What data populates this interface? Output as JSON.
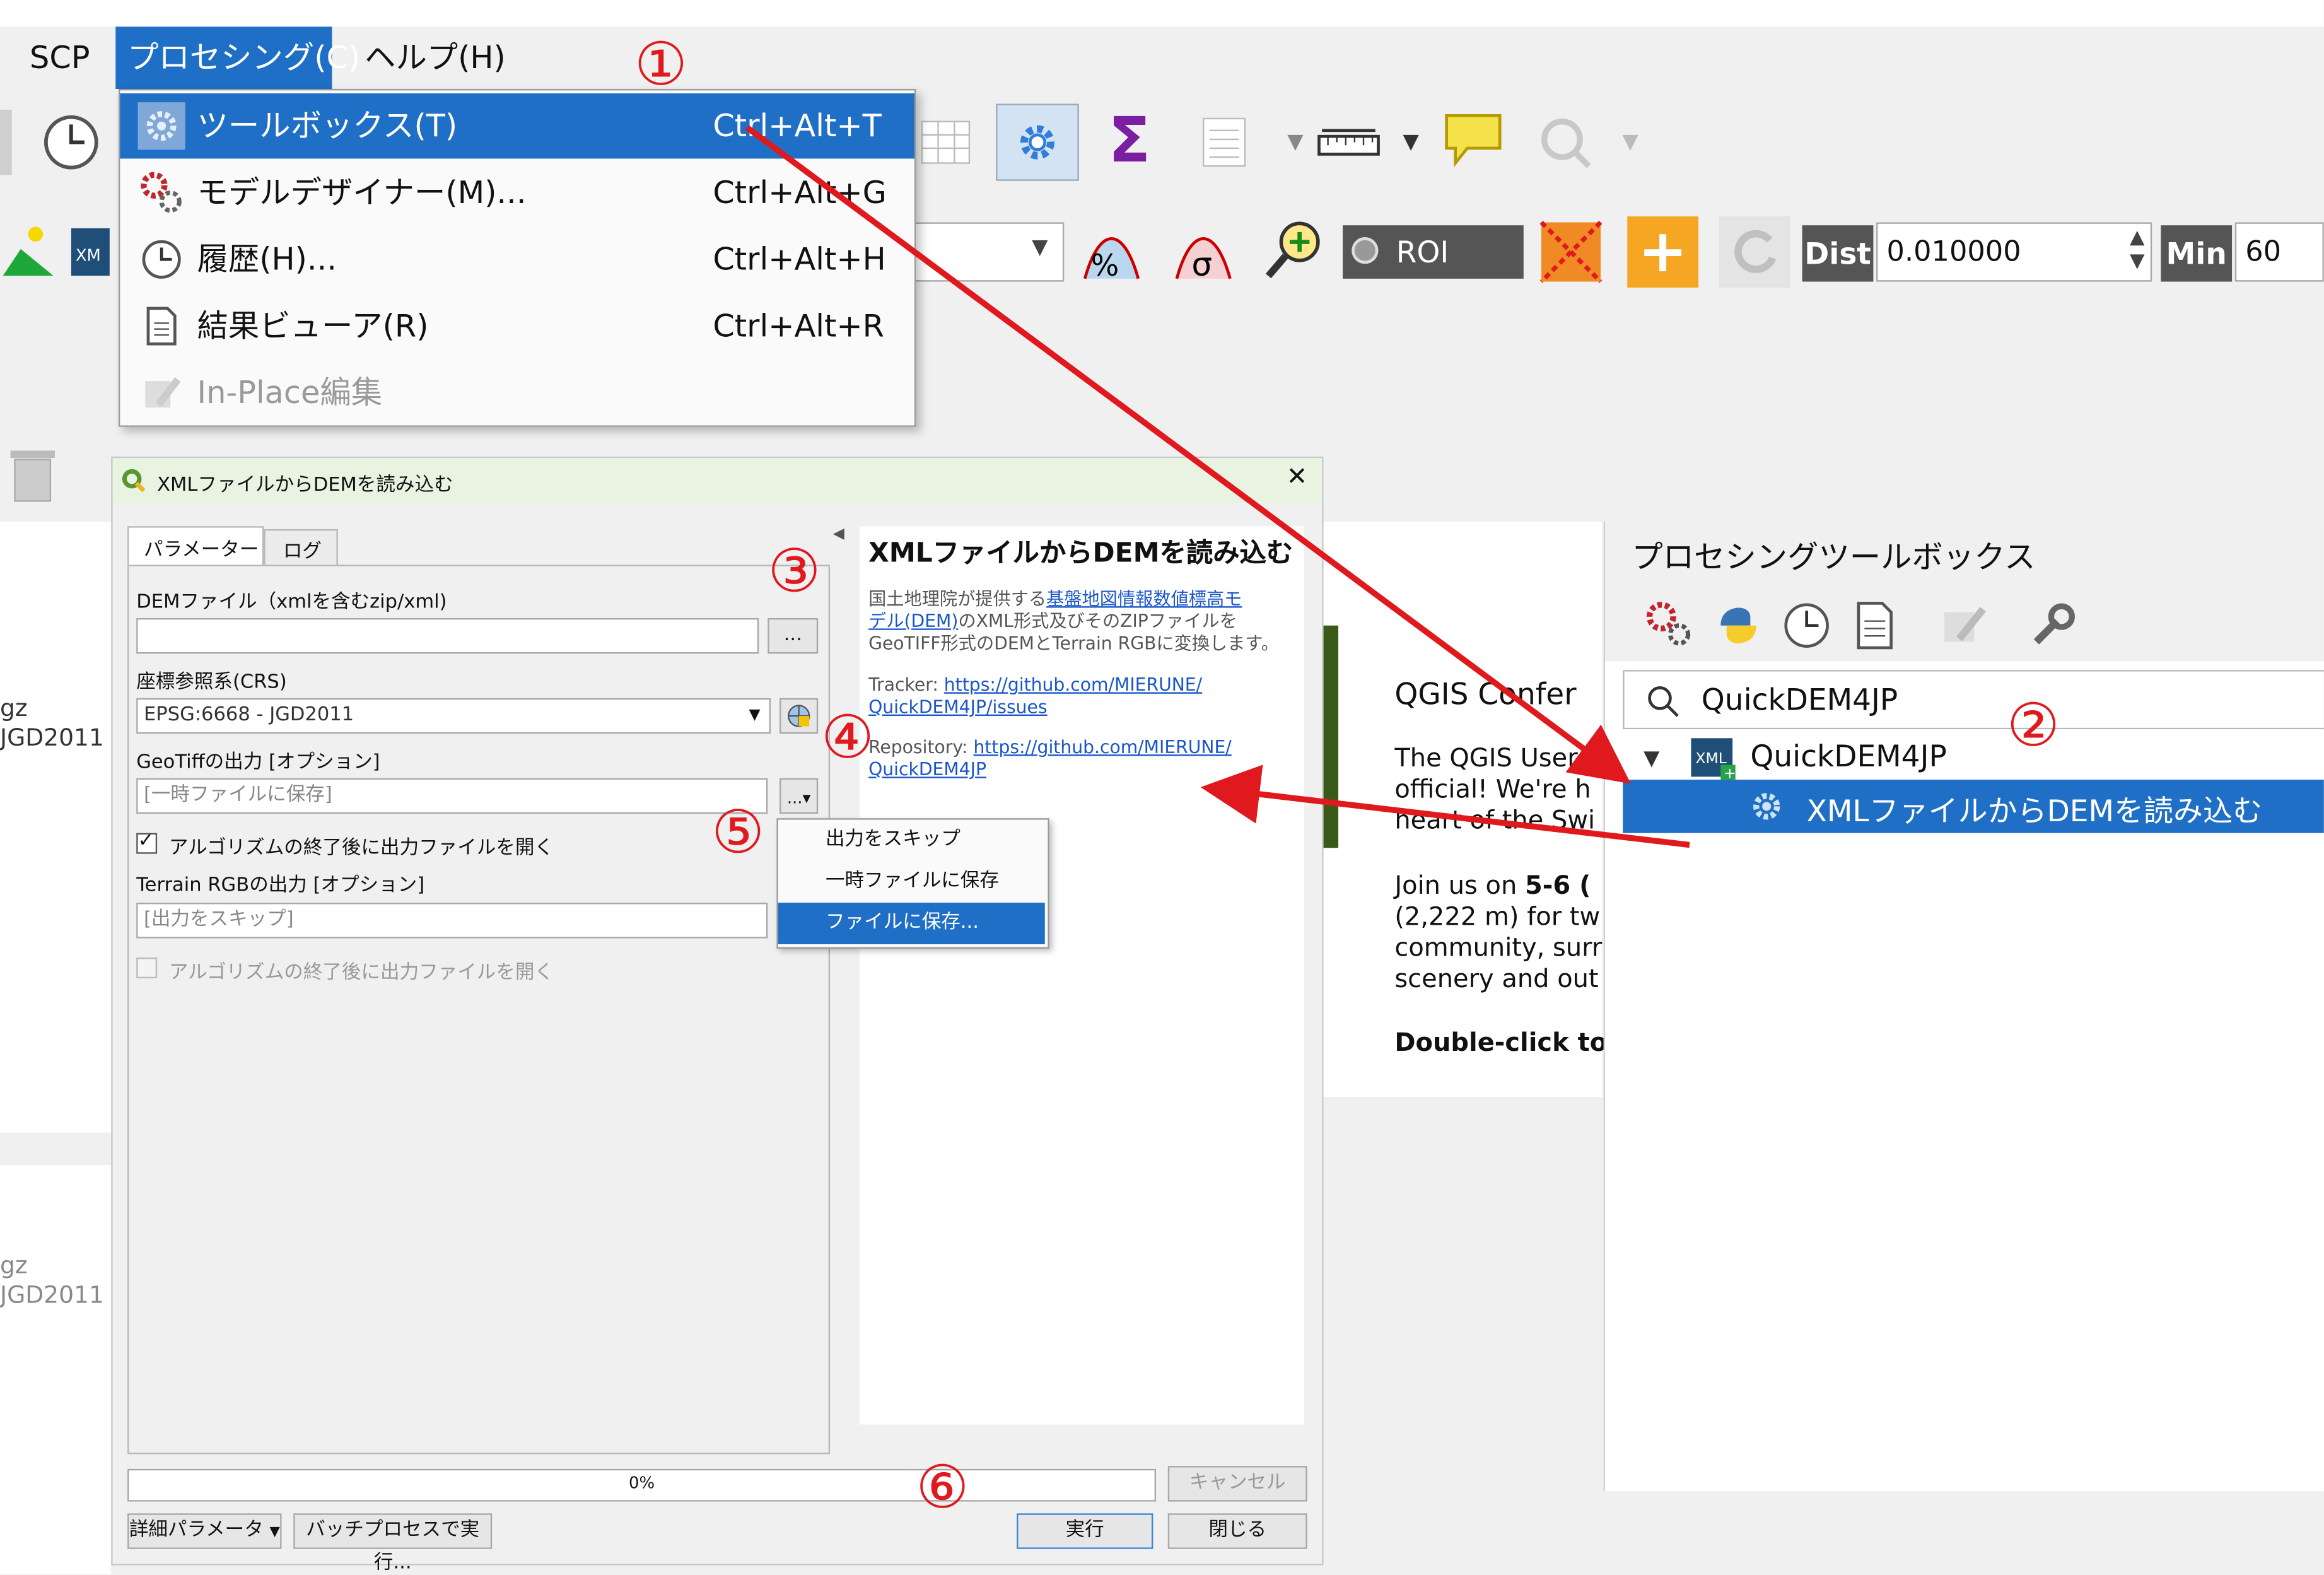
{
  "menubar": {
    "items": [
      "SCP",
      "プロセシング(C)",
      "ヘルプ(H)"
    ]
  },
  "processing_menu": {
    "items": [
      {
        "label": "ツールボックス(T)",
        "shortcut": "Ctrl+Alt+T",
        "icon": "gear-icon"
      },
      {
        "label": "モデルデザイナー(M)...",
        "shortcut": "Ctrl+Alt+G",
        "icon": "model-designer-icon"
      },
      {
        "label": "履歴(H)...",
        "shortcut": "Ctrl+Alt+H",
        "icon": "clock-icon"
      },
      {
        "label": "結果ビューア(R)",
        "shortcut": "Ctrl+Alt+R",
        "icon": "document-icon"
      },
      {
        "label": "In-Place編集",
        "shortcut": "",
        "icon": "edit-in-place-icon"
      }
    ]
  },
  "toolbar2": {
    "roi_label": "ROI",
    "dist_label": "Dist",
    "dist_value": "0.010000",
    "min_label": "Min",
    "min_value": "60"
  },
  "left_panel": {
    "crs_line1": "gz",
    "crs_line2": "JGD2011",
    "crs_line3": "gz",
    "crs_line4": "JGD2011"
  },
  "dialog": {
    "title": "XMLファイルからDEMを読み込む",
    "close_glyph": "✕",
    "tabs": [
      "パラメーター",
      "ログ"
    ],
    "dem_label": "DEMファイル（xmlを含むzip/xml)",
    "dem_value": "",
    "browse_label": "...",
    "crs_label": "座標参照系(CRS)",
    "crs_value": "EPSG:6668 - JGD2011",
    "geotiff_label": "GeoTiffの出力 [オプション]",
    "geotiff_placeholder": "[一時ファイルに保存]",
    "open_after_label": "アルゴリズムの終了後に出力ファイルを開く",
    "terrain_label": "Terrain RGBの出力 [オプション]",
    "terrain_placeholder": "[出力をスキップ]",
    "open_after_label2": "アルゴリズムの終了後に出力ファイルを開く",
    "help_title": "XMLファイルからDEMを読み込む",
    "help_desc_pre": "国土地理院が提供する",
    "help_desc_link1": "基盤地図情報数値標高モ",
    "help_desc_link2": "デル(DEM)",
    "help_desc_post1": "のXML形式及びそのZIPファイルを",
    "help_desc_post2": "GeoTIFF形式のDEMとTerrain RGBに変換します。",
    "tracker_label": "Tracker: ",
    "tracker_link1": "https://github.com/MIERUNE/",
    "tracker_link2": "QuickDEM4JP/issues",
    "repo_label": "Repository: ",
    "repo_link1": "https://github.com/MIERUNE/",
    "repo_link2": "QuickDEM4JP",
    "progress_value": 0,
    "progress_text": "0%",
    "cancel_label": "キャンセル",
    "advanced_label": "詳細パラメータ",
    "batch_label": "バッチプロセスで実行...",
    "run_label": "実行",
    "close_label": "閉じる"
  },
  "output_popup": {
    "items": [
      "出力をスキップ",
      "一時ファイルに保存",
      "ファイルに保存..."
    ]
  },
  "news": {
    "title": "QGIS Confer",
    "p1_l1": "The QGIS User",
    "p1_l2": "official! We're h",
    "p1_l3": "heart of the Swi",
    "p2_l1_pre": "Join us on ",
    "p2_l1_bold": "5-6 (",
    "p2_l2": "(2,222 m) for tw",
    "p2_l3": "community, surr",
    "p2_l4": "scenery and out",
    "p3": "Double-click to"
  },
  "toolbox": {
    "title": "プロセシングツールボックス",
    "search_value": "QuickDEM4JP",
    "provider": "QuickDEM4JP",
    "algorithm": "XMLファイルからDEMを読み込む"
  },
  "annotations": {
    "step1": "①",
    "step2": "②",
    "step3": "③",
    "step4": "④",
    "step5": "⑤",
    "step6": "⑥",
    "arrow_color": "#e0191e"
  }
}
